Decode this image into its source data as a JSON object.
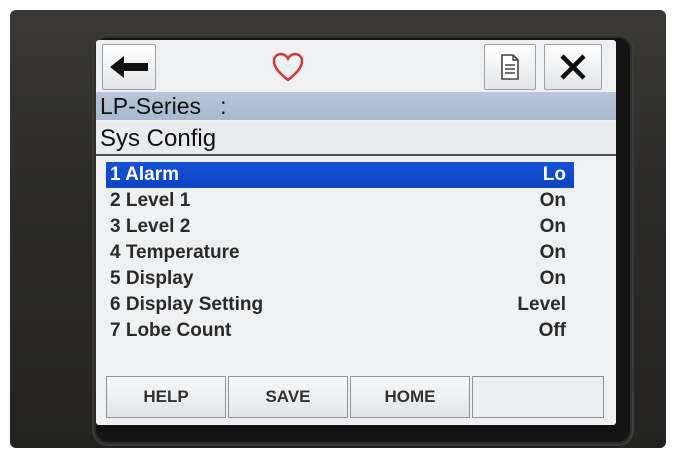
{
  "header": {
    "device_name": "LP-Series   :",
    "screen_title": "Sys Config"
  },
  "toolbar": {
    "back_icon": "arrow-left",
    "favorite_icon": "heart-outline",
    "document_icon": "document",
    "close_icon": "x"
  },
  "menu": {
    "items": [
      {
        "label": "1 Alarm",
        "value": "Lo"
      },
      {
        "label": "2 Level 1",
        "value": "On"
      },
      {
        "label": "3 Level 2",
        "value": "On"
      },
      {
        "label": "4 Temperature",
        "value": "On"
      },
      {
        "label": "5 Display",
        "value": "On"
      },
      {
        "label": "6 Display Setting",
        "value": "Level"
      },
      {
        "label": "7 Lobe Count",
        "value": "Off"
      }
    ],
    "selected_index": 0
  },
  "softkeys": {
    "help": "HELP",
    "save": "SAVE",
    "home": "HOME",
    "blank": ""
  },
  "colors": {
    "selection": "#0a44c2",
    "device_bar": "#b9c6da",
    "heart": "#d23a3a"
  }
}
